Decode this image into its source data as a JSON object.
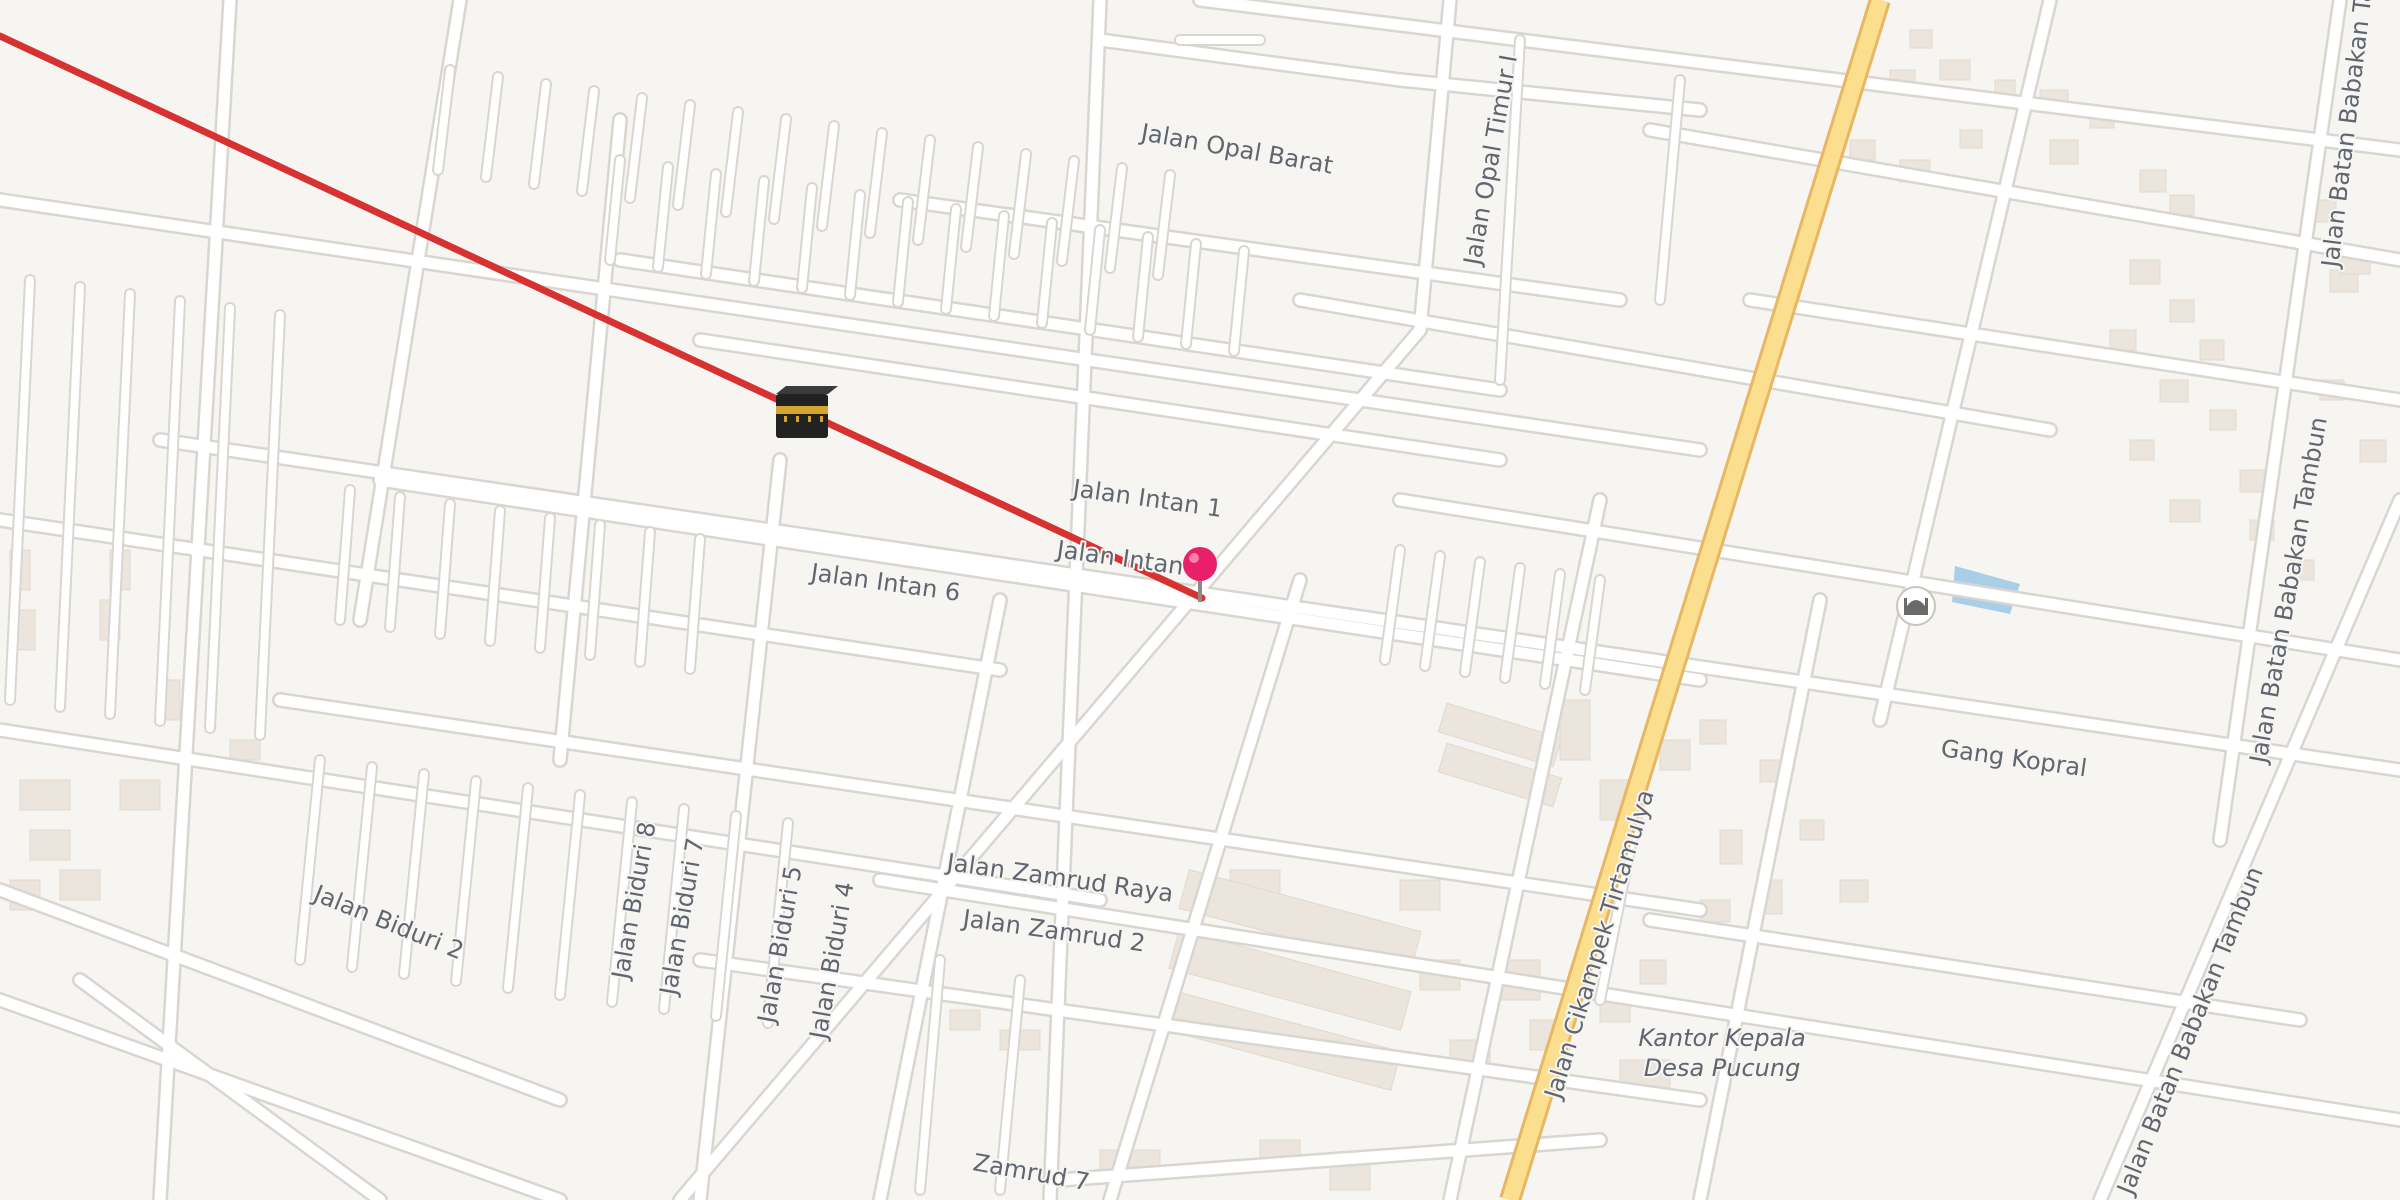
{
  "streets": {
    "opal_barat": "Jalan Opal Barat",
    "opal_timur": "Jalan Opal Timur I",
    "intan_1": "Jalan Intan 1",
    "intan_3": "Jalan Intan 3",
    "intan_6": "Jalan Intan 6",
    "zamrud_raya": "Jalan Zamrud Raya",
    "zamrud_2": "Jalan Zamrud 2",
    "zamrud_7": "Zamrud 7",
    "biduri_2": "Jalan Biduri 2",
    "biduri_8": "Jalan Biduri 8",
    "biduri_7": "Jalan Biduri 7",
    "biduri_5": "Jalan Biduri 5",
    "biduri_4": "Jalan Biduri 4",
    "cikampek": "Jalan Cikampek Tirtamulya",
    "gang_kopral": "Gang Kopral",
    "babakan_top": "Jalan Batan Babakan Ta",
    "babakan_mid": "Jalan Batan Babakan Tambun",
    "babakan_bottom": "Jalan Batan Babakan Tambun"
  },
  "pois": {
    "kantor_line1": "Kantor Kepala",
    "kantor_line2": "Desa Pucung"
  },
  "markers": {
    "kaaba_icon": "kaaba-icon",
    "location_pin": "location-pin-icon",
    "mosque_icon": "mosque-icon"
  },
  "colors": {
    "background": "#f7f5f2",
    "road": "#ffffff",
    "road_casing": "#d9d6d1",
    "main_road": "#fbdf8f",
    "main_road_casing": "#e8b764",
    "qibla_line": "#d63232",
    "pin": "#e8206a",
    "water": "#a9cfe8",
    "building": "#ebe5dd"
  }
}
